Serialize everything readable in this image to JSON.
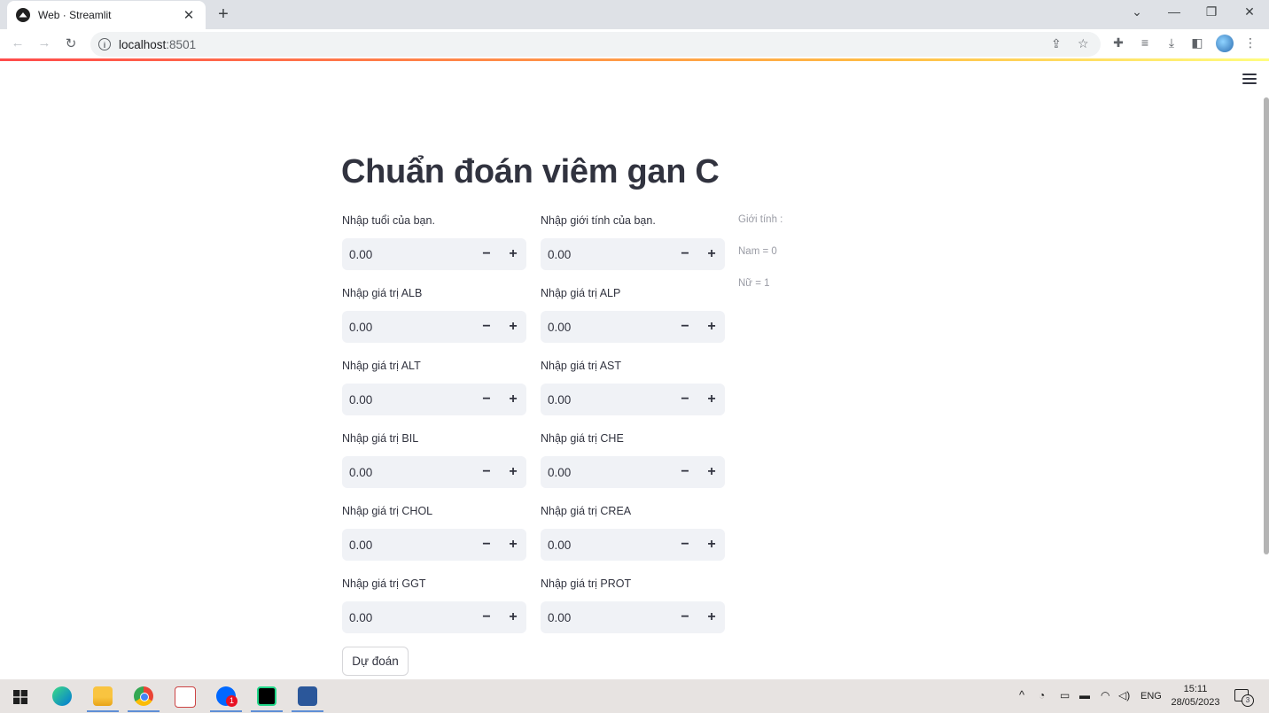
{
  "browser": {
    "tab_title": "Web · Streamlit",
    "tab_close": "✕",
    "new_tab": "+",
    "url_host": "localhost",
    "url_port": ":8501",
    "window_controls": {
      "dropdown": "⌄",
      "minimize": "—",
      "restore": "❐",
      "close": "✕"
    }
  },
  "app": {
    "title": "Chuẩn đoán viêm gan C",
    "left_fields": [
      {
        "label": "Nhập tuổi của bạn.",
        "value": "0.00"
      },
      {
        "label": "Nhập giá trị ALB",
        "value": "0.00"
      },
      {
        "label": "Nhập giá trị ALT",
        "value": "0.00"
      },
      {
        "label": "Nhập giá trị BIL",
        "value": "0.00"
      },
      {
        "label": "Nhập giá trị CHOL",
        "value": "0.00"
      },
      {
        "label": "Nhập giá trị GGT",
        "value": "0.00"
      }
    ],
    "right_fields": [
      {
        "label": "Nhập giới tính của bạn.",
        "value": "0.00"
      },
      {
        "label": "Nhập giá trị ALP",
        "value": "0.00"
      },
      {
        "label": "Nhập giá trị AST",
        "value": "0.00"
      },
      {
        "label": "Nhập giá trị CHE",
        "value": "0.00"
      },
      {
        "label": "Nhập giá trị CREA",
        "value": "0.00"
      },
      {
        "label": "Nhập giá trị PROT",
        "value": "0.00"
      }
    ],
    "stepper_minus": "−",
    "stepper_plus": "+",
    "gender_note": {
      "heading": "Giới tính :",
      "male": "Nam = 0",
      "female": "Nữ = 1"
    },
    "predict_button": "Dự đoán"
  },
  "taskbar": {
    "zalo_badge": "1",
    "language": "ENG",
    "time": "15:11",
    "date": "28/05/2023",
    "notification_count": "3"
  }
}
